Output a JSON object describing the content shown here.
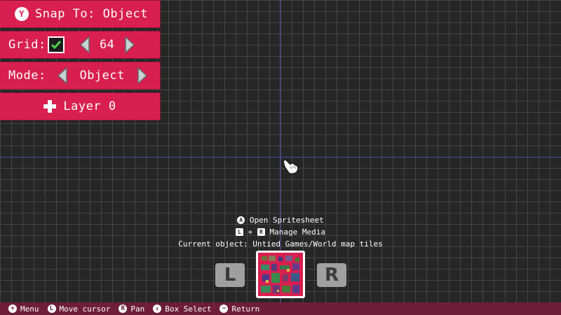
{
  "toolbar": {
    "snap_button_glyph": "Y",
    "snap_label": "Snap To: Object",
    "grid_label": "Grid:",
    "grid_checked": true,
    "grid_size": "64",
    "mode_label": "Mode:",
    "mode_value": "Object",
    "layer_label": "Layer 0"
  },
  "hints": {
    "open_spritesheet_key": "A",
    "open_spritesheet": "Open Spritesheet",
    "manage_media_key_l": "L",
    "manage_media_plus": "+",
    "manage_media_key_r": "R",
    "manage_media": "Manage Media",
    "current_object": "Current object: Untied Games/World map tiles"
  },
  "selector": {
    "prev_label": "L",
    "next_label": "R"
  },
  "bottom_bar": [
    {
      "icon": "+",
      "label": "Menu"
    },
    {
      "icon": "L",
      "label": "Move cursor"
    },
    {
      "icon": "R",
      "label": "Pan"
    },
    {
      "icon": "↓",
      "label": "Box Select"
    },
    {
      "icon": "−",
      "label": "Return"
    }
  ],
  "colors": {
    "panel": "#d81f4f",
    "grid_bg": "#262626",
    "grid_line": "#454545",
    "axis": "#4a4aa6",
    "bottom_bar": "#6e1e39"
  }
}
